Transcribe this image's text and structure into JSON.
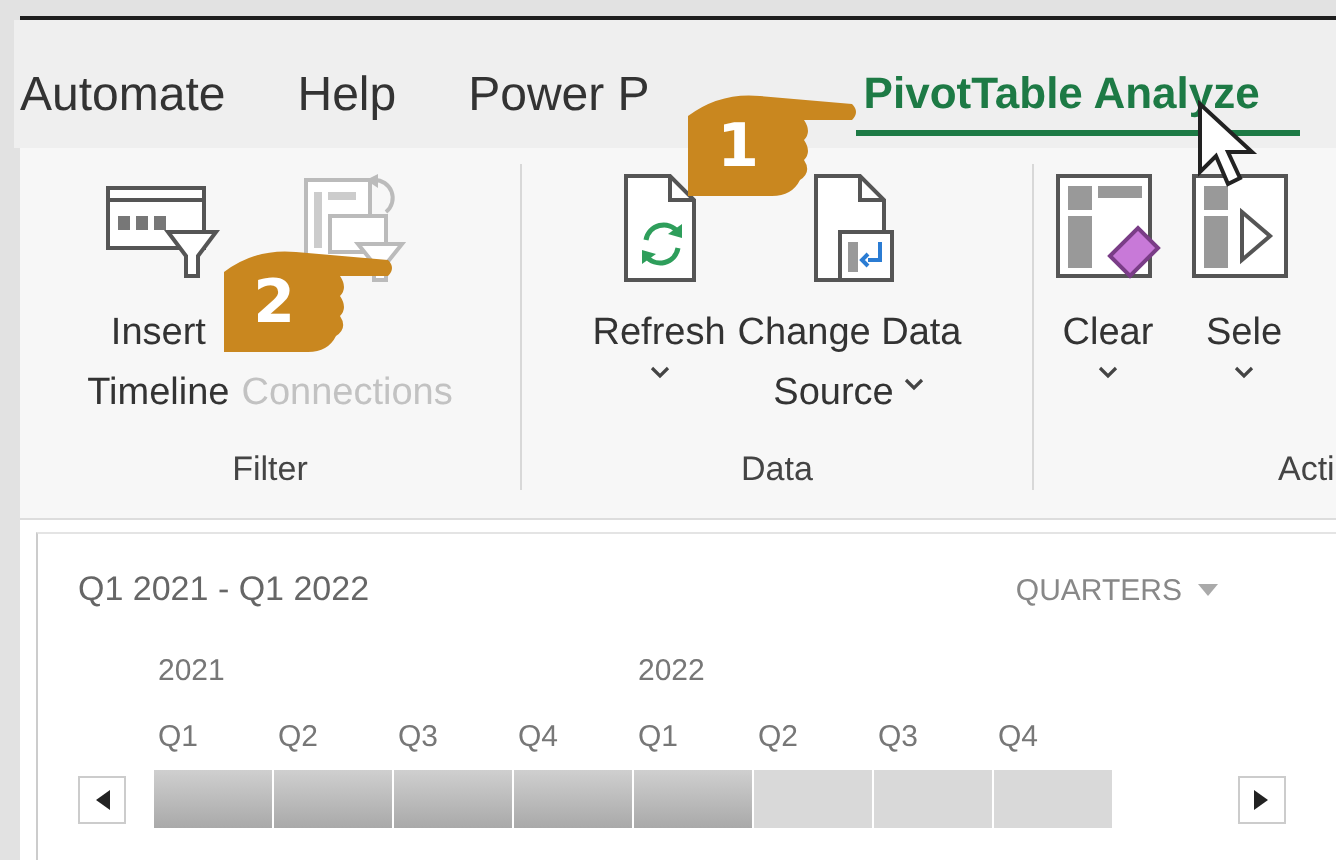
{
  "tabs": [
    {
      "label": "Automate",
      "selected": false
    },
    {
      "label": "Help",
      "selected": false
    },
    {
      "label": "Power P",
      "selected": false
    },
    {
      "label": "PivotTable Analyze",
      "selected": true
    }
  ],
  "ribbon": {
    "groups": [
      {
        "label": "Filter",
        "buttons": [
          {
            "kind": "insert-timeline",
            "lines": [
              "Insert",
              "Timeline"
            ],
            "disabled": false,
            "dropdown": false
          },
          {
            "kind": "filter-connections",
            "lines": [
              "Connections"
            ],
            "disabled": true,
            "dropdown": false
          }
        ]
      },
      {
        "label": "Data",
        "buttons": [
          {
            "kind": "refresh",
            "lines": [
              "Refresh"
            ],
            "disabled": false,
            "dropdown": true
          },
          {
            "kind": "change-data-source",
            "lines": [
              "Change Data",
              "Source"
            ],
            "disabled": false,
            "dropdown": true
          }
        ]
      },
      {
        "label": "Acti",
        "buttons": [
          {
            "kind": "clear",
            "lines": [
              "Clear"
            ],
            "disabled": false,
            "dropdown": true
          },
          {
            "kind": "select",
            "lines": [
              "Sele"
            ],
            "disabled": false,
            "dropdown": true
          }
        ]
      }
    ]
  },
  "callouts": [
    {
      "number": "1",
      "kind": "tab"
    },
    {
      "number": "2",
      "kind": "button"
    }
  ],
  "timeline": {
    "range": "Q1 2021 - Q1 2022",
    "level": "QUARTERS",
    "years": [
      {
        "label": "2021",
        "quarters": [
          {
            "label": "Q1",
            "selected": true
          },
          {
            "label": "Q2",
            "selected": true
          },
          {
            "label": "Q3",
            "selected": true
          },
          {
            "label": "Q4",
            "selected": true
          }
        ]
      },
      {
        "label": "2022",
        "quarters": [
          {
            "label": "Q1",
            "selected": true
          },
          {
            "label": "Q2",
            "selected": false
          },
          {
            "label": "Q3",
            "selected": false
          },
          {
            "label": "Q4",
            "selected": false
          }
        ]
      }
    ]
  }
}
